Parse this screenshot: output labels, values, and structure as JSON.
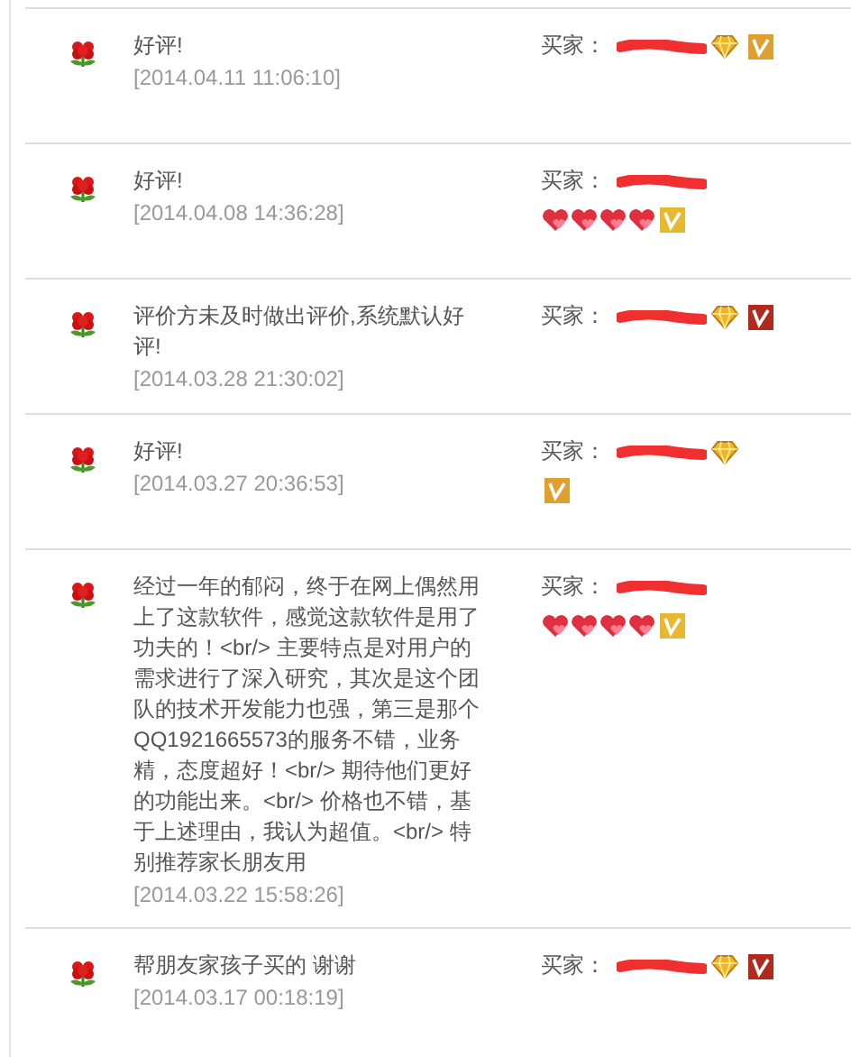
{
  "reviews": [
    {
      "comment": "好评!",
      "date": "[2014.04.11 11:06:10]",
      "buyer_label": "买家：",
      "badges": [
        {
          "kind": "diamond"
        },
        {
          "kind": "vip",
          "color": "#e0a030"
        }
      ]
    },
    {
      "comment": "好评!",
      "date": "[2014.04.08 14:36:28]",
      "buyer_label": "买家：",
      "second_line_badges": [
        {
          "kind": "heart"
        },
        {
          "kind": "heart"
        },
        {
          "kind": "heart"
        },
        {
          "kind": "heart"
        },
        {
          "kind": "vip",
          "color": "#e8b830"
        }
      ]
    },
    {
      "comment": "评价方未及时做出评价,系统默认好评!",
      "date": "[2014.03.28 21:30:02]",
      "buyer_label": "买家：",
      "badges": [
        {
          "kind": "diamond"
        },
        {
          "kind": "vip",
          "color": "#b02a20"
        }
      ]
    },
    {
      "comment": "好评!",
      "date": "[2014.03.27 20:36:53]",
      "buyer_label": "买家：",
      "badges": [
        {
          "kind": "diamond"
        }
      ],
      "second_line_badges": [
        {
          "kind": "vip",
          "color": "#e0a030"
        }
      ]
    },
    {
      "comment": "经过一年的郁闷，终于在网上偶然用上了这款软件，感觉这款软件是用了功夫的！<br/> 主要特点是对用户的需求进行了深入研究，其次是这个团队的技术开发能力也强，第三是那个QQ1921665573的服务不错，业务精，态度超好！<br/> 期待他们更好的功能出来。<br/> 价格也不错，基于上述理由，我认为超值。<br/> 特别推荐家长朋友用",
      "date": "[2014.03.22 15:58:26]",
      "buyer_label": "买家：",
      "second_line_badges": [
        {
          "kind": "heart"
        },
        {
          "kind": "heart"
        },
        {
          "kind": "heart"
        },
        {
          "kind": "heart"
        },
        {
          "kind": "vip",
          "color": "#e8b830"
        }
      ]
    },
    {
      "comment": "帮朋友家孩子买的 谢谢",
      "date": "[2014.03.17 00:18:19]",
      "buyer_label": "买家：",
      "badges": [
        {
          "kind": "diamond"
        },
        {
          "kind": "vip",
          "color": "#b02a20"
        }
      ]
    }
  ]
}
